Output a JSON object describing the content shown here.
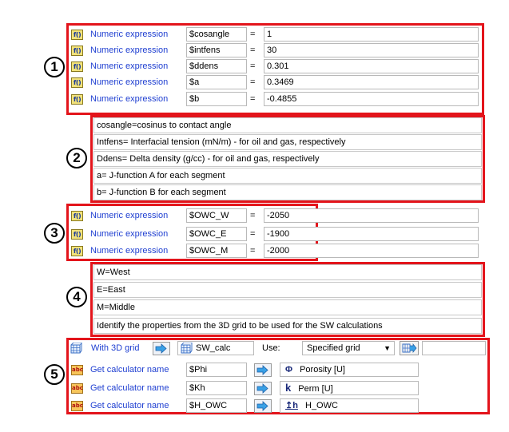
{
  "section1": {
    "number": "1",
    "rows": [
      {
        "icon": "f()",
        "label": "Numeric expression",
        "var": "$cosangle",
        "eq": "=",
        "value": "1"
      },
      {
        "icon": "f()",
        "label": "Numeric expression",
        "var": "$intfens",
        "eq": "=",
        "value": "30"
      },
      {
        "icon": "f()",
        "label": "Numeric expression",
        "var": "$ddens",
        "eq": "=",
        "value": "0.301"
      },
      {
        "icon": "f()",
        "label": "Numeric expression",
        "var": "$a",
        "eq": "=",
        "value": "0.3469"
      },
      {
        "icon": "f()",
        "label": "Numeric expression",
        "var": "$b",
        "eq": "=",
        "value": "-0.4855"
      }
    ]
  },
  "section2": {
    "number": "2",
    "notes": [
      "cosangle=cosinus to contact angle",
      "Intfens= Interfacial tension (mN/m) -  for oil and gas, respectively",
      "Ddens= Delta density (g/cc)  - for oil and gas, respectively",
      "a= J-function A for each segment",
      "b= J-function B for each segment"
    ]
  },
  "section3": {
    "number": "3",
    "rows": [
      {
        "icon": "f()",
        "label": "Numeric expression",
        "var": "$OWC_W",
        "eq": "=",
        "value": "-2050"
      },
      {
        "icon": "f()",
        "label": "Numeric expression",
        "var": "$OWC_E",
        "eq": "=",
        "value": "-1900"
      },
      {
        "icon": "f()",
        "label": "Numeric expression",
        "var": "$OWC_M",
        "eq": "=",
        "value": "-2000"
      }
    ]
  },
  "section4": {
    "number": "4",
    "notes": [
      "W=West",
      "E=East",
      "M=Middle",
      "Identify the properties from the 3D grid to be used for the SW calculations"
    ]
  },
  "section5": {
    "number": "5",
    "grid_row": {
      "label": "With 3D grid",
      "grid_name": "SW_calc",
      "use_label": "Use:",
      "use_value": "Specified grid"
    },
    "rows": [
      {
        "icon": "abc",
        "label": "Get calculator name",
        "var": "$Phi",
        "prop_symbol": "Φ",
        "prop": "Porosity [U]"
      },
      {
        "icon": "abc",
        "label": "Get calculator name",
        "var": "$Kh",
        "prop_symbol": "k",
        "prop": "Perm [U]"
      },
      {
        "icon": "abc",
        "label": "Get calculator name",
        "var": "$H_OWC",
        "prop_symbol": "↥h",
        "prop": "H_OWC"
      }
    ]
  },
  "colors": {
    "highlight_border": "#e3141b",
    "label_blue": "#1f3fd1"
  }
}
